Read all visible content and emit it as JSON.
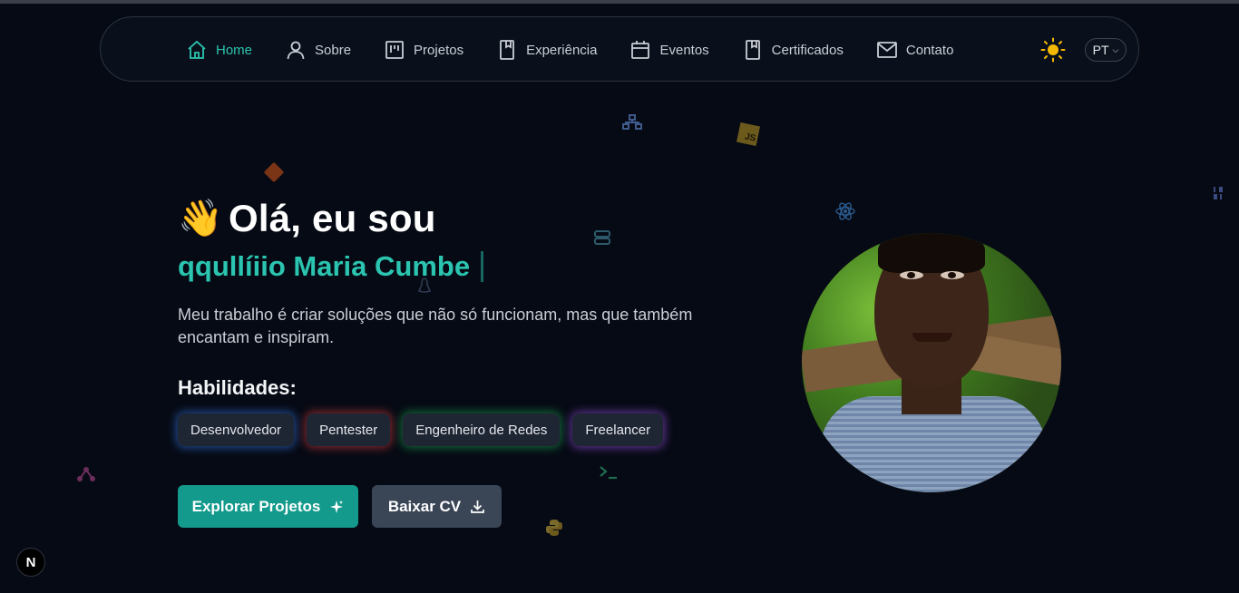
{
  "nav": {
    "items": [
      {
        "label": "Home",
        "icon": "home-icon",
        "active": true
      },
      {
        "label": "Sobre",
        "icon": "user-icon",
        "active": false
      },
      {
        "label": "Projetos",
        "icon": "kanban-icon",
        "active": false
      },
      {
        "label": "Experiência",
        "icon": "bookmark-icon",
        "active": false
      },
      {
        "label": "Eventos",
        "icon": "calendar-icon",
        "active": false
      },
      {
        "label": "Certificados",
        "icon": "bookmark-icon",
        "active": false
      },
      {
        "label": "Contato",
        "icon": "mail-icon",
        "active": false
      }
    ],
    "theme_icon": "sun-icon",
    "language": "PT"
  },
  "hero": {
    "wave_emoji": "👋",
    "greeting": "Olá, eu sou",
    "typed_name": "qqullíiio Maria Cumbe",
    "tagline": "Meu trabalho é criar soluções que não só funcionam, mas que também encantam e inspiram.",
    "skills_title": "Habilidades:",
    "skills": [
      {
        "label": "Desenvolvedor",
        "glow": "#3b82f6"
      },
      {
        "label": "Pentester",
        "glow": "#ef4444"
      },
      {
        "label": "Engenheiro de Redes",
        "glow": "#22c55e"
      },
      {
        "label": "Freelancer",
        "glow": "#a855f7"
      }
    ],
    "primary_button": "Explorar Projetos",
    "secondary_button": "Baixar CV"
  },
  "badge": {
    "label": "N"
  },
  "colors": {
    "accent": "#2bc4b0",
    "background": "#060a14",
    "primary_button": "#139a8c",
    "secondary_button": "#3a4556"
  }
}
